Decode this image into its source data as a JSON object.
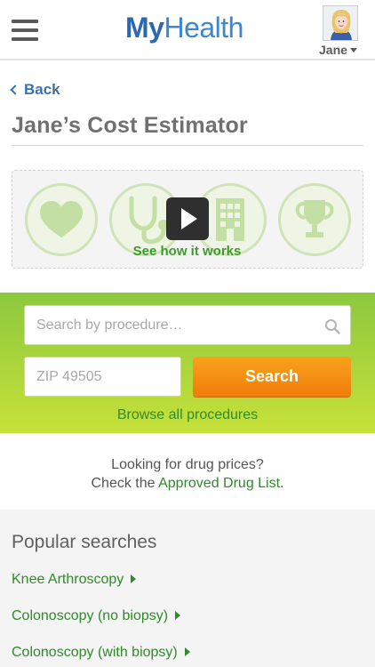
{
  "header": {
    "brand_bold": "My",
    "brand_light": "Health",
    "user_name": "Jane"
  },
  "nav": {
    "back_label": "Back"
  },
  "page": {
    "title": "Jane’s Cost Estimator"
  },
  "video": {
    "cta_label": "See how it works",
    "icons": [
      "heart-icon",
      "stethoscope-icon",
      "hospital-building-icon",
      "trophy-icon"
    ]
  },
  "search": {
    "procedure_placeholder": "Search by procedure…",
    "zip_placeholder": "ZIP 49505",
    "button_label": "Search",
    "browse_all_label": "Browse all procedures"
  },
  "drug_prices": {
    "line1": "Looking for drug prices?",
    "line2_prefix": "Check the ",
    "link_label": "Approved Drug List",
    "line2_suffix": "."
  },
  "popular": {
    "heading": "Popular searches",
    "items": [
      {
        "label": "Knee Arthroscopy"
      },
      {
        "label": "Colonoscopy (no biopsy)"
      },
      {
        "label": "Colonoscopy (with biopsy)"
      }
    ]
  },
  "colors": {
    "brand_blue": "#2c67b1",
    "link_green": "#2f8a2a",
    "band_green_top": "#8cc83e",
    "band_green_bottom": "#c7e139",
    "search_orange": "#ef7d0b"
  }
}
